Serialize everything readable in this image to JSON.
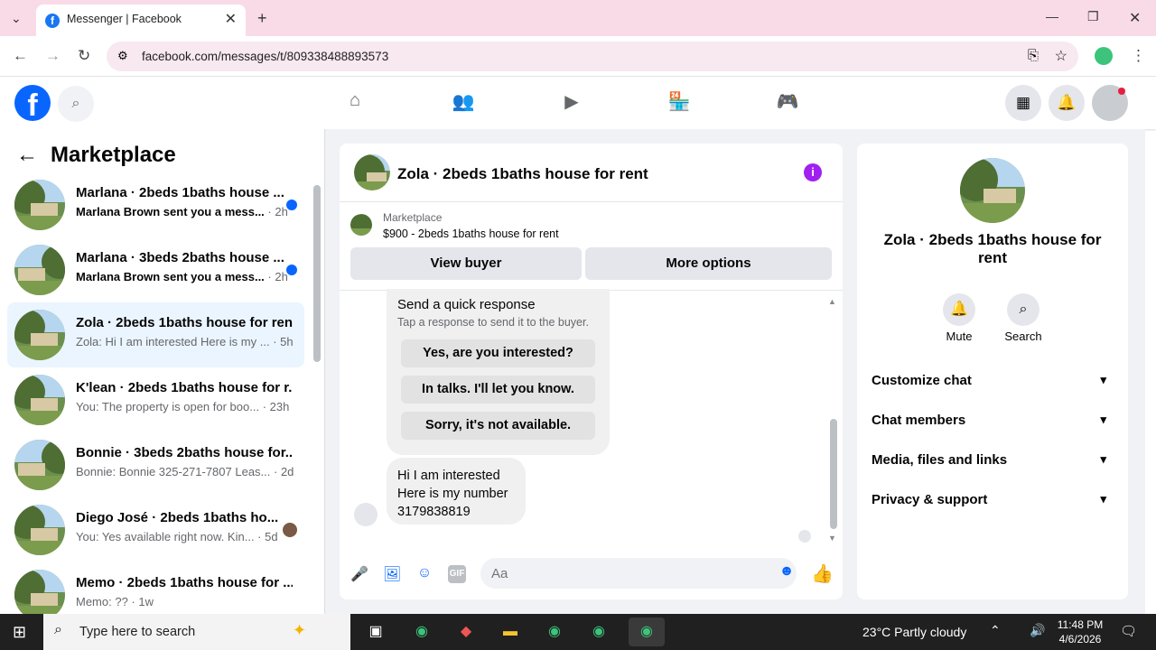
{
  "browser": {
    "tab_title": "Messenger | Facebook",
    "tab_favicon": "f",
    "url": "facebook.com/messages/t/809338488893573"
  },
  "colors": {
    "brand": "#0866ff",
    "unread_dot": "#0866ff",
    "info": "#a020f0",
    "tabbar": "#f9dbe7"
  },
  "left": {
    "title": "Marketplace",
    "conversations": [
      {
        "name": "Marlana · 2beds 1baths house ...",
        "preview": "Marlana Brown sent you a mess...",
        "time": " · 2h",
        "unread": true
      },
      {
        "name": "Marlana · 3beds 2baths house ...",
        "preview": "Marlana Brown sent you a mess...",
        "time": " · 2h",
        "unread": true
      },
      {
        "name": "Zola · 2beds 1baths house for rent",
        "preview": "Zola: Hi I am interested Here is my ...",
        "time": " · 5h",
        "selected": true
      },
      {
        "name": "K'lean · 2beds 1baths house for r...",
        "preview": "You: The property is open for boo...",
        "time": " · 23h"
      },
      {
        "name": "Bonnie · 3beds 2baths house for...",
        "preview": "Bonnie: Bonnie 325-271-7807 Leas...",
        "time": " · 2d"
      },
      {
        "name": "Diego José · 2beds 1baths ho...",
        "preview": "You: Yes available right now. Kin...",
        "time": " · 5d"
      },
      {
        "name": "Memo · 2beds 1baths house for ...",
        "preview": "Memo: ??",
        "time": " · 1w"
      }
    ]
  },
  "chat": {
    "title": "Zola · 2beds 1baths house for rent",
    "info_icon": "i",
    "listing_label": "Marketplace",
    "listing_title": "$900 - 2beds 1baths house for rent",
    "view_buyer": "View buyer",
    "more_options": "More options",
    "quick_response_title": "Send a quick response",
    "quick_response_sub": "Tap a response to send it to the buyer.",
    "quick_responses": [
      "Yes, are you interested?",
      "In talks. I'll let you know.",
      "Sorry, it's not available."
    ],
    "message": "Hi I am interested\nHere is my number\n3179838819",
    "input_placeholder": "Aa"
  },
  "right": {
    "name": "Zola · 2beds 1baths house for rent",
    "mute": "Mute",
    "search": "Search",
    "sections": [
      "Customize chat",
      "Chat members",
      "Media, files and links",
      "Privacy & support"
    ]
  },
  "taskbar": {
    "search_placeholder": "Type here to search",
    "weather": "23°C  Partly cloudy",
    "time": "11:48 PM",
    "date": "4/6/2026"
  }
}
